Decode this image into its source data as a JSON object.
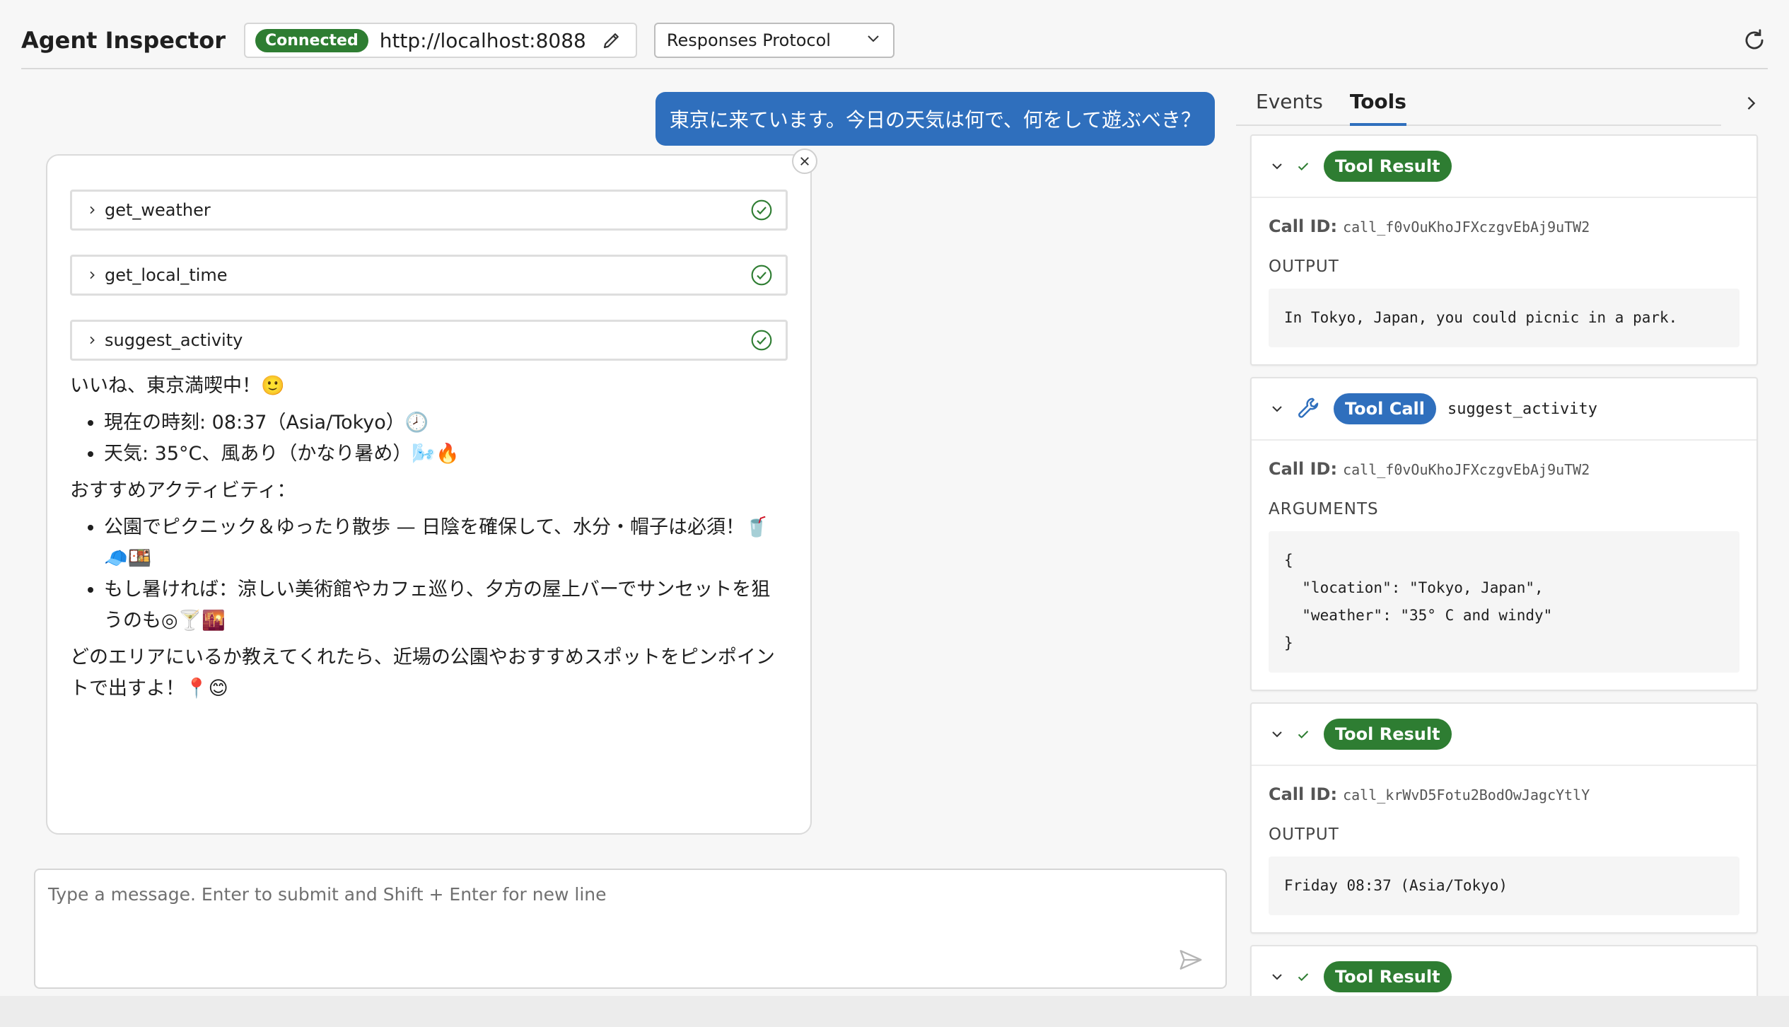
{
  "header": {
    "title": "Agent Inspector",
    "status": "Connected",
    "url": "http://localhost:8088",
    "protocol": "Responses Protocol"
  },
  "chat": {
    "user_message": "東京に来ています。今日の天気は何で、何をして遊ぶべき？",
    "tools": [
      {
        "name": "get_weather"
      },
      {
        "name": "get_local_time"
      },
      {
        "name": "suggest_activity"
      }
    ],
    "reply": {
      "greeting": "いいね、東京満喫中！🙂",
      "facts": [
        "現在の時刻: 08:37（Asia/Tokyo）🕗",
        "天気: 35°C、風あり（かなり暑め）🌬️🔥"
      ],
      "activities_heading": "おすすめアクティビティ：",
      "activities": [
        "公園でピクニック＆ゆったり散歩 — 日陰を確保して、水分・帽子は必須！🥤🧢🍱",
        "もし暑ければ：涼しい美術館やカフェ巡り、夕方の屋上バーでサンセットを狙うのも◎🍸🌇"
      ],
      "closing": "どのエリアにいるか教えてくれたら、近場の公園やおすすめスポットをピンポイントで出すよ！📍😊"
    },
    "composer_placeholder": "Type a message. Enter to submit and Shift + Enter for new line"
  },
  "panel": {
    "tabs": [
      "Events",
      "Tools"
    ],
    "active_tab": "Tools",
    "events": [
      {
        "kind": "Tool Result",
        "call_id_label": "Call ID:",
        "call_id": "call_f0vOuKhoJFXczgvEbAj9uTW2",
        "section": "OUTPUT",
        "content": "In Tokyo, Japan, you could picnic in a park."
      },
      {
        "kind": "Tool Call",
        "function": "suggest_activity",
        "call_id_label": "Call ID:",
        "call_id": "call_f0vOuKhoJFXczgvEbAj9uTW2",
        "section": "ARGUMENTS",
        "content": "{\n  \"location\": \"Tokyo, Japan\",\n  \"weather\": \"35° C and windy\"\n}"
      },
      {
        "kind": "Tool Result",
        "call_id_label": "Call ID:",
        "call_id": "call_krWvD5Fotu2BodOwJagcYtlY",
        "section": "OUTPUT",
        "content": "Friday 08:37 (Asia/Tokyo)"
      },
      {
        "kind": "Tool Result"
      }
    ]
  },
  "colors": {
    "accent": "#2f6fbd",
    "success": "#2e7d32"
  },
  "icons": [
    "pencil-icon",
    "chevron-down-icon",
    "refresh-icon",
    "close-icon",
    "chevron-right-icon",
    "check-circle-icon",
    "send-icon",
    "check-icon",
    "wrench-icon"
  ]
}
